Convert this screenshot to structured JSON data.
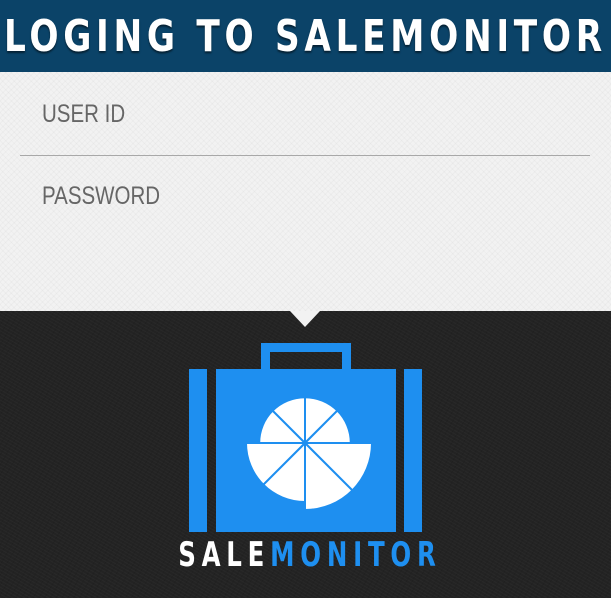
{
  "header": {
    "title": "LOGING TO SALEMONITOR"
  },
  "form": {
    "user_id_placeholder": "USER ID",
    "password_placeholder": "PASSWORD"
  },
  "brand": {
    "part1": "SALE",
    "part2": "MONITOR"
  },
  "icons": {
    "logo": "briefcase-pie-chart-icon"
  },
  "colors": {
    "header_bg": "#0b4368",
    "accent_blue": "#1e8ff0",
    "dark_bg": "#232323",
    "form_bg": "#f2f2f2"
  }
}
